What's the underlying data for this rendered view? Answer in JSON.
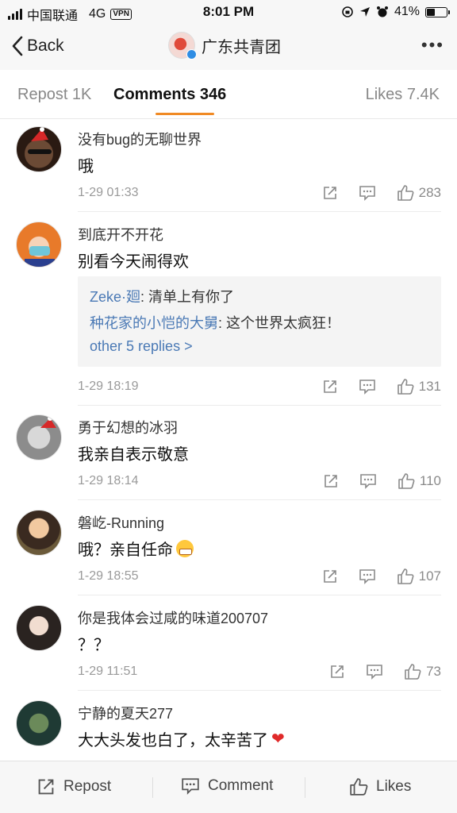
{
  "status_bar": {
    "carrier": "中国联通",
    "network": "4G",
    "vpn": "VPN",
    "time": "8:01 PM",
    "battery": "41%",
    "battery_level": 0.41
  },
  "nav": {
    "back_label": "Back",
    "title": "广东共青团",
    "more": "•••"
  },
  "tabs": {
    "repost": "Repost 1K",
    "comments": "Comments 346",
    "likes": "Likes 7.4K"
  },
  "comments": [
    {
      "user": "没有bug的无聊世界",
      "text": "哦",
      "time": "1-29 01:33",
      "likes": "283"
    },
    {
      "user": "到底开不开花",
      "text": "别看今天闹得欢",
      "time": "1-29 18:19",
      "likes": "131",
      "replies": [
        {
          "user": "Zeke·廻",
          "text": ": 清单上有你了"
        },
        {
          "user": "种花家的小恺的大舅",
          "text": ": 这个世界太疯狂！"
        }
      ],
      "more_replies": "other 5 replies >"
    },
    {
      "user": "勇于幻想的冰羽",
      "text": "我亲自表示敬意",
      "time": "1-29 18:14",
      "likes": "110"
    },
    {
      "user": "磐屹-Running",
      "text": "哦？亲自任命",
      "time": "1-29 18:55",
      "likes": "107"
    },
    {
      "user": "你是我体会过咸的味道200707",
      "text": "？？",
      "time": "1-29 11:51",
      "likes": "73"
    },
    {
      "user": "宁静的夏天277",
      "text": "大大头发也白了，太辛苦了"
    }
  ],
  "bottom_bar": {
    "repost": "Repost",
    "comment": "Comment",
    "likes": "Likes"
  },
  "icons": {
    "accent": "#f08a24",
    "link": "#4a79b5"
  }
}
